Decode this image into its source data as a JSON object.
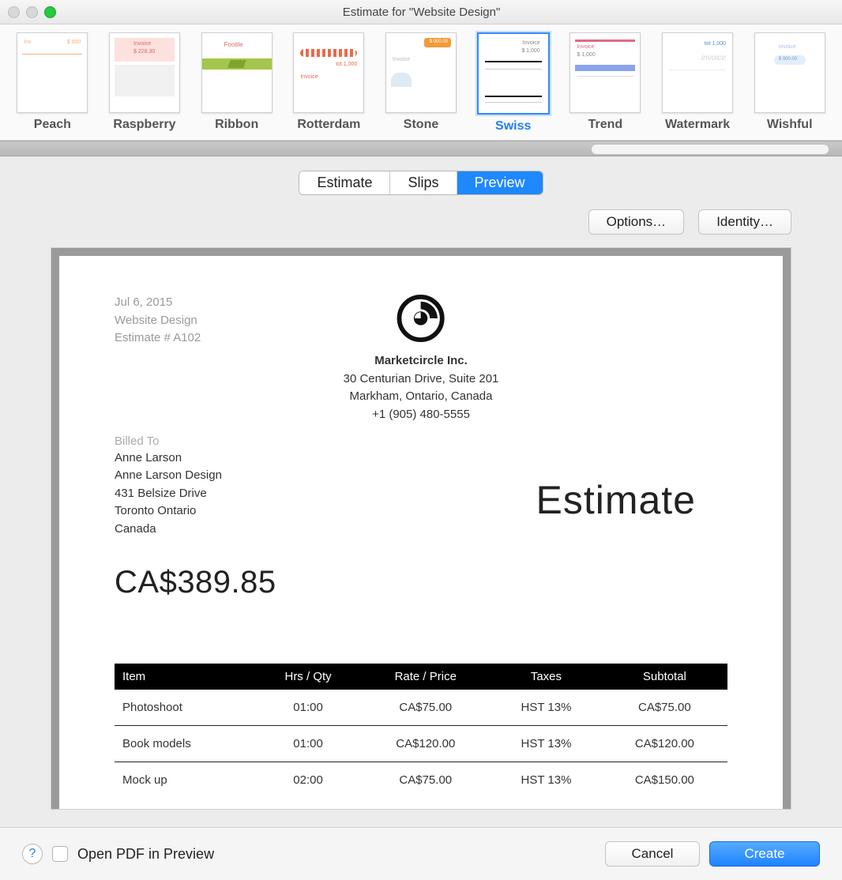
{
  "window_title": "Estimate for \"Website Design\"",
  "templates": [
    {
      "label": "Peach"
    },
    {
      "label": "Raspberry"
    },
    {
      "label": "Ribbon"
    },
    {
      "label": "Rotterdam"
    },
    {
      "label": "Stone"
    },
    {
      "label": "Swiss",
      "selected": true
    },
    {
      "label": "Trend"
    },
    {
      "label": "Watermark"
    },
    {
      "label": "Wishful"
    }
  ],
  "segments": {
    "estimate": "Estimate",
    "slips": "Slips",
    "preview": "Preview",
    "active": "preview"
  },
  "buttons": {
    "options": "Options…",
    "identity": "Identity…",
    "cancel": "Cancel",
    "create": "Create"
  },
  "bottom": {
    "open_pdf_label": "Open PDF in Preview",
    "open_pdf_checked": false
  },
  "document": {
    "date": "Jul 6, 2015",
    "project": "Website Design",
    "estimate_no": "Estimate # A102",
    "company": {
      "name": "Marketcircle Inc.",
      "address1": "30 Centurian Drive, Suite 201",
      "address2": "Markham, Ontario, Canada",
      "phone": "+1 (905) 480-5555"
    },
    "billed_to_label": "Billed To",
    "billed_to": {
      "name": "Anne Larson",
      "company": "Anne Larson Design",
      "address": "431 Belsize Drive",
      "city": "Toronto Ontario",
      "country": "Canada"
    },
    "doc_title": "Estimate",
    "total": "CA$389.85",
    "columns": {
      "item": "Item",
      "hrs": "Hrs / Qty",
      "rate": "Rate / Price",
      "taxes": "Taxes",
      "subtotal": "Subtotal"
    },
    "rows": [
      {
        "item": "Photoshoot",
        "hrs": "01:00",
        "rate": "CA$75.00",
        "taxes": "HST 13%",
        "subtotal": "CA$75.00"
      },
      {
        "item": "Book models",
        "hrs": "01:00",
        "rate": "CA$120.00",
        "taxes": "HST 13%",
        "subtotal": "CA$120.00"
      },
      {
        "item": "Mock up",
        "hrs": "02:00",
        "rate": "CA$75.00",
        "taxes": "HST 13%",
        "subtotal": "CA$150.00"
      }
    ]
  }
}
